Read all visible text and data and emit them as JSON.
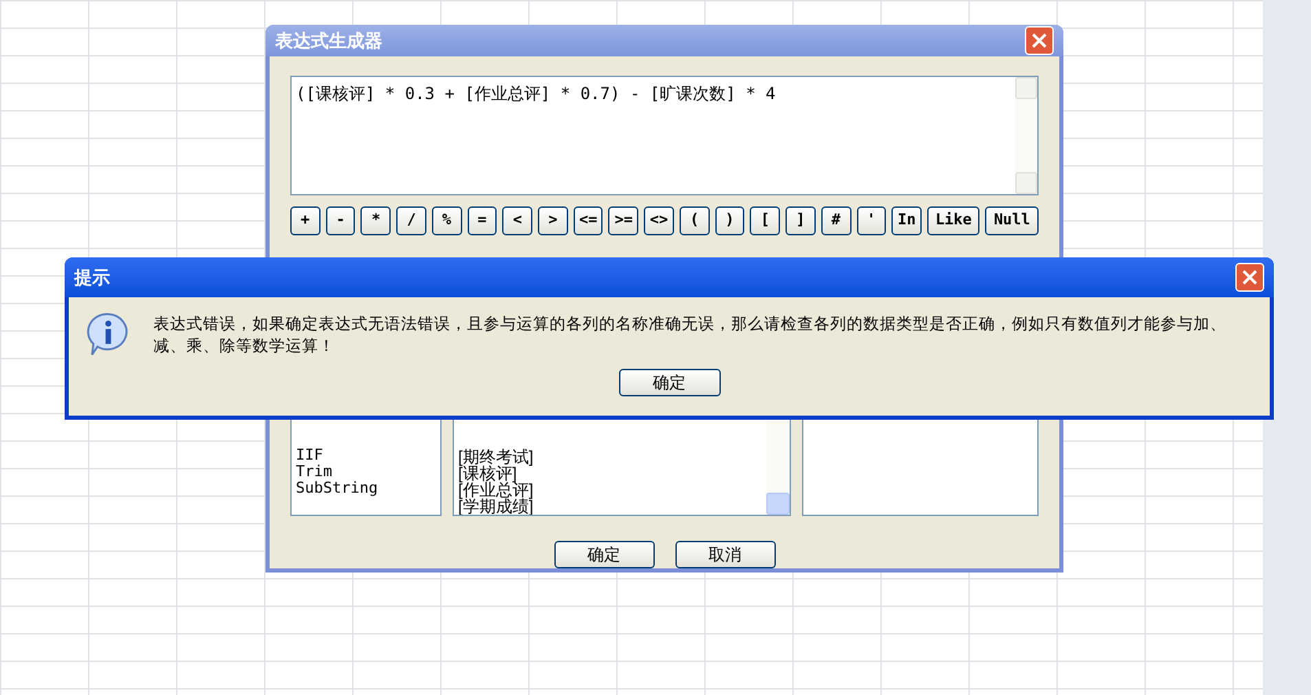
{
  "builder": {
    "title": "表达式生成器",
    "expression": "([课核评] * 0.3 + [作业总评] * 0.7) - [旷课次数] * 4",
    "operators": [
      "+",
      "-",
      "*",
      "/",
      "%",
      "=",
      "<",
      ">",
      "<=",
      ">=",
      "<>",
      "(",
      ")",
      "[",
      "]",
      "#",
      "'",
      "In",
      "Like",
      "Null"
    ],
    "functions": [
      "IIF",
      "Trim",
      "SubString"
    ],
    "columns": [
      "[期终考试]",
      "[课核评]",
      "[作业总评]",
      "[学期成绩]"
    ],
    "buttons": [
      "确定",
      "取消"
    ]
  },
  "message": {
    "title": "提示",
    "text": "表达式错误，如果确定表达式无语法错误，且参与运算的各列的名称准确无误，那么请检查各列的数据类型是否正确，例如只有数值列才能参与加、减、乘、除等数学运算！",
    "button": "确定"
  }
}
